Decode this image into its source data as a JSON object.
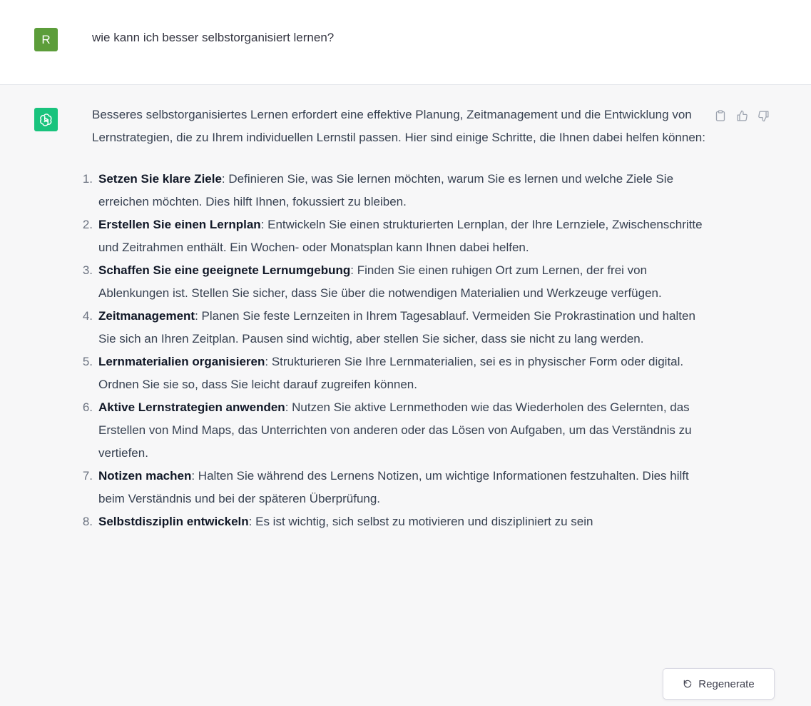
{
  "user": {
    "avatar_letter": "R",
    "message": "wie kann ich besser selbstorganisiert lernen?"
  },
  "assistant": {
    "intro": "Besseres selbstorganisiertes Lernen erfordert eine effektive Planung, Zeitmanagement und die Entwicklung von Lernstrategien, die zu Ihrem individuellen Lernstil passen. Hier sind einige Schritte, die Ihnen dabei helfen können:",
    "steps": [
      {
        "num": "1.",
        "title": "Setzen Sie klare Ziele",
        "text": ": Definieren Sie, was Sie lernen möchten, warum Sie es lernen und welche Ziele Sie erreichen möchten. Dies hilft Ihnen, fokussiert zu bleiben."
      },
      {
        "num": "2.",
        "title": "Erstellen Sie einen Lernplan",
        "text": ": Entwickeln Sie einen strukturierten Lernplan, der Ihre Lernziele, Zwischenschritte und Zeitrahmen enthält. Ein Wochen- oder Monatsplan kann Ihnen dabei helfen."
      },
      {
        "num": "3.",
        "title": "Schaffen Sie eine geeignete Lernumgebung",
        "text": ": Finden Sie einen ruhigen Ort zum Lernen, der frei von Ablenkungen ist. Stellen Sie sicher, dass Sie über die notwendigen Materialien und Werkzeuge verfügen."
      },
      {
        "num": "4.",
        "title": "Zeitmanagement",
        "text": ": Planen Sie feste Lernzeiten in Ihrem Tagesablauf. Vermeiden Sie Prokrastination und halten Sie sich an Ihren Zeitplan. Pausen sind wichtig, aber stellen Sie sicher, dass sie nicht zu lang werden."
      },
      {
        "num": "5.",
        "title": "Lernmaterialien organisieren",
        "text": ": Strukturieren Sie Ihre Lernmaterialien, sei es in physischer Form oder digital. Ordnen Sie sie so, dass Sie leicht darauf zugreifen können."
      },
      {
        "num": "6.",
        "title": "Aktive Lernstrategien anwenden",
        "text": ": Nutzen Sie aktive Lernmethoden wie das Wiederholen des Gelernten, das Erstellen von Mind Maps, das Unterrichten von anderen oder das Lösen von Aufgaben, um das Verständnis zu vertiefen."
      },
      {
        "num": "7.",
        "title": "Notizen machen",
        "text": ": Halten Sie während des Lernens Notizen, um wichtige Informationen festzuhalten. Dies hilft beim Verständnis und bei der späteren Überprüfung."
      },
      {
        "num": "8.",
        "title": "Selbstdisziplin entwickeln",
        "text": ": Es ist wichtig, sich selbst zu motivieren und diszipliniert zu sein"
      }
    ]
  },
  "actions": {
    "copy_icon": "clipboard-icon",
    "like_icon": "thumbs-up-icon",
    "dislike_icon": "thumbs-down-icon"
  },
  "regenerate": {
    "label": "Regenerate",
    "icon": "refresh-icon"
  },
  "colors": {
    "user_avatar": "#5c9d3a",
    "bot_avatar": "#19c37d",
    "assistant_bg": "#f7f7f8"
  }
}
